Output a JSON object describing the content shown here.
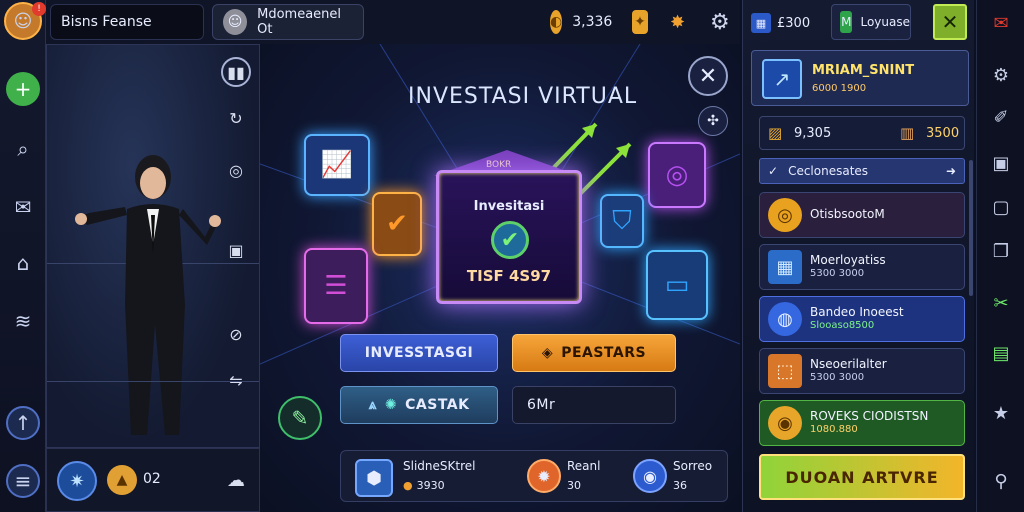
{
  "player": {
    "name": "Bisns Feanse",
    "badge": "!"
  },
  "opponent": {
    "name": "Mdomeaenel Ot"
  },
  "resources": {
    "coins": "3,336"
  },
  "main": {
    "title": "INVESTASI VIRTUAL",
    "banner_tag": "BOKR",
    "card_title": "Invesitasi",
    "card_value": "TISF 4S97",
    "btn_invest": "INVESSTASGI",
    "btn_rewards": "PEASTARS",
    "btn_cash": "CASTAK",
    "field_value": "6Mr"
  },
  "bottom_bar": {
    "item1_label": "SlidneSKtrel",
    "item1_value": "3930",
    "item2_label": "Reanl",
    "item2_value": "30",
    "item3_label": "Sorreo",
    "item3_value": "36"
  },
  "left_bottom": {
    "count": "02"
  },
  "right_panel": {
    "top_value": "£300",
    "top_label": "Loyuase",
    "header_title": "MRIAM_SNINT",
    "header_sub": "6000 1900",
    "stat1": "9,305",
    "stat2": "3500",
    "section": "Ceclonesates",
    "quests": [
      {
        "title": "OtisbsootoM",
        "sub": ""
      },
      {
        "title": "Moerloyatiss",
        "sub": "5300 3000"
      },
      {
        "title": "Bandeo Inoeest",
        "sub": "Slooaso8500"
      },
      {
        "title": "Nseoerilalter",
        "sub": "5300 3000"
      },
      {
        "title": "ROVEKS CIODISTSN",
        "sub": "1080.880"
      }
    ],
    "cta": "DUOAN ARTVRE"
  },
  "colors": {
    "accent_orange": "#f39a22",
    "accent_green": "#5fcf3a",
    "accent_blue": "#3a63d8",
    "accent_purple": "#8d49d8",
    "panel_dark": "#0f1427"
  }
}
